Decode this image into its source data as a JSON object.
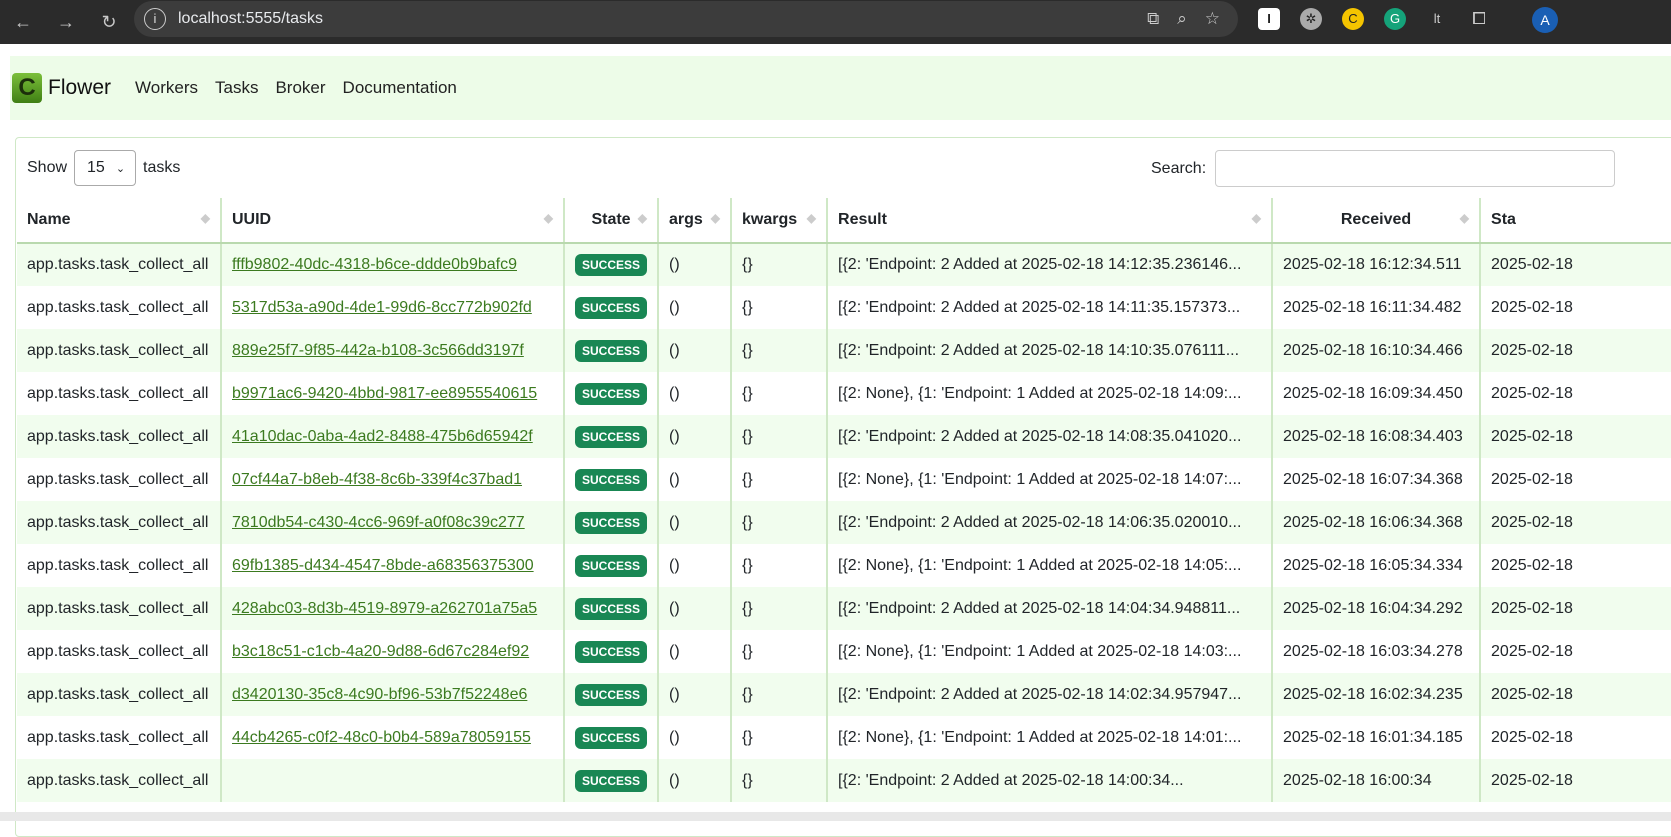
{
  "browser": {
    "url": "localhost:5555/tasks",
    "avatar": "A"
  },
  "navbar": {
    "brand": "Flower",
    "links": [
      "Workers",
      "Tasks",
      "Broker",
      "Documentation"
    ]
  },
  "controls": {
    "show_label": "Show",
    "page_size": "15",
    "tasks_label": "tasks",
    "search_label": "Search:",
    "search_value": ""
  },
  "table": {
    "headers": [
      "Name",
      "UUID",
      "State",
      "args",
      "kwargs",
      "Result",
      "Received",
      "Sta"
    ],
    "rows": [
      {
        "name": "app.tasks.task_collect_all",
        "uuid": "fffb9802-40dc-4318-b6ce-ddde0b9bafc9",
        "state": "SUCCESS",
        "args": "()",
        "kwargs": "{}",
        "result": "[{2: 'Endpoint: 2 Added at 2025-02-18 14:12:35.236146...",
        "received": "2025-02-18 16:12:34.511",
        "started": "2025-02-18"
      },
      {
        "name": "app.tasks.task_collect_all",
        "uuid": "5317d53a-a90d-4de1-99d6-8cc772b902fd",
        "state": "SUCCESS",
        "args": "()",
        "kwargs": "{}",
        "result": "[{2: 'Endpoint: 2 Added at 2025-02-18 14:11:35.157373...",
        "received": "2025-02-18 16:11:34.482",
        "started": "2025-02-18"
      },
      {
        "name": "app.tasks.task_collect_all",
        "uuid": "889e25f7-9f85-442a-b108-3c566dd3197f",
        "state": "SUCCESS",
        "args": "()",
        "kwargs": "{}",
        "result": "[{2: 'Endpoint: 2 Added at 2025-02-18 14:10:35.076111...",
        "received": "2025-02-18 16:10:34.466",
        "started": "2025-02-18"
      },
      {
        "name": "app.tasks.task_collect_all",
        "uuid": "b9971ac6-9420-4bbd-9817-ee8955540615",
        "state": "SUCCESS",
        "args": "()",
        "kwargs": "{}",
        "result": "[{2: None}, {1: 'Endpoint: 1 Added at 2025-02-18 14:09:...",
        "received": "2025-02-18 16:09:34.450",
        "started": "2025-02-18"
      },
      {
        "name": "app.tasks.task_collect_all",
        "uuid": "41a10dac-0aba-4ad2-8488-475b6d65942f",
        "state": "SUCCESS",
        "args": "()",
        "kwargs": "{}",
        "result": "[{2: 'Endpoint: 2 Added at 2025-02-18 14:08:35.041020...",
        "received": "2025-02-18 16:08:34.403",
        "started": "2025-02-18"
      },
      {
        "name": "app.tasks.task_collect_all",
        "uuid": "07cf44a7-b8eb-4f38-8c6b-339f4c37bad1",
        "state": "SUCCESS",
        "args": "()",
        "kwargs": "{}",
        "result": "[{2: None}, {1: 'Endpoint: 1 Added at 2025-02-18 14:07:...",
        "received": "2025-02-18 16:07:34.368",
        "started": "2025-02-18"
      },
      {
        "name": "app.tasks.task_collect_all",
        "uuid": "7810db54-c430-4cc6-969f-a0f08c39c277",
        "state": "SUCCESS",
        "args": "()",
        "kwargs": "{}",
        "result": "[{2: 'Endpoint: 2 Added at 2025-02-18 14:06:35.020010...",
        "received": "2025-02-18 16:06:34.368",
        "started": "2025-02-18"
      },
      {
        "name": "app.tasks.task_collect_all",
        "uuid": "69fb1385-d434-4547-8bde-a68356375300",
        "state": "SUCCESS",
        "args": "()",
        "kwargs": "{}",
        "result": "[{2: None}, {1: 'Endpoint: 1 Added at 2025-02-18 14:05:...",
        "received": "2025-02-18 16:05:34.334",
        "started": "2025-02-18"
      },
      {
        "name": "app.tasks.task_collect_all",
        "uuid": "428abc03-8d3b-4519-8979-a262701a75a5",
        "state": "SUCCESS",
        "args": "()",
        "kwargs": "{}",
        "result": "[{2: 'Endpoint: 2 Added at 2025-02-18 14:04:34.948811...",
        "received": "2025-02-18 16:04:34.292",
        "started": "2025-02-18"
      },
      {
        "name": "app.tasks.task_collect_all",
        "uuid": "b3c18c51-c1cb-4a20-9d88-6d67c284ef92",
        "state": "SUCCESS",
        "args": "()",
        "kwargs": "{}",
        "result": "[{2: None}, {1: 'Endpoint: 1 Added at 2025-02-18 14:03:...",
        "received": "2025-02-18 16:03:34.278",
        "started": "2025-02-18"
      },
      {
        "name": "app.tasks.task_collect_all",
        "uuid": "d3420130-35c8-4c90-bf96-53b7f52248e6",
        "state": "SUCCESS",
        "args": "()",
        "kwargs": "{}",
        "result": "[{2: 'Endpoint: 2 Added at 2025-02-18 14:02:34.957947...",
        "received": "2025-02-18 16:02:34.235",
        "started": "2025-02-18"
      },
      {
        "name": "app.tasks.task_collect_all",
        "uuid": "44cb4265-c0f2-48c0-b0b4-589a78059155",
        "state": "SUCCESS",
        "args": "()",
        "kwargs": "{}",
        "result": "[{2: None}, {1: 'Endpoint: 1 Added at 2025-02-18 14:01:...",
        "received": "2025-02-18 16:01:34.185",
        "started": "2025-02-18"
      },
      {
        "name": "app.tasks.task_collect_all",
        "uuid": "",
        "state": "SUCCESS",
        "args": "()",
        "kwargs": "{}",
        "result": "[{2: 'Endpoint: 2 Added at 2025-02-18 14:00:34...",
        "received": "2025-02-18 16:00:34",
        "started": "2025-02-18"
      }
    ]
  }
}
